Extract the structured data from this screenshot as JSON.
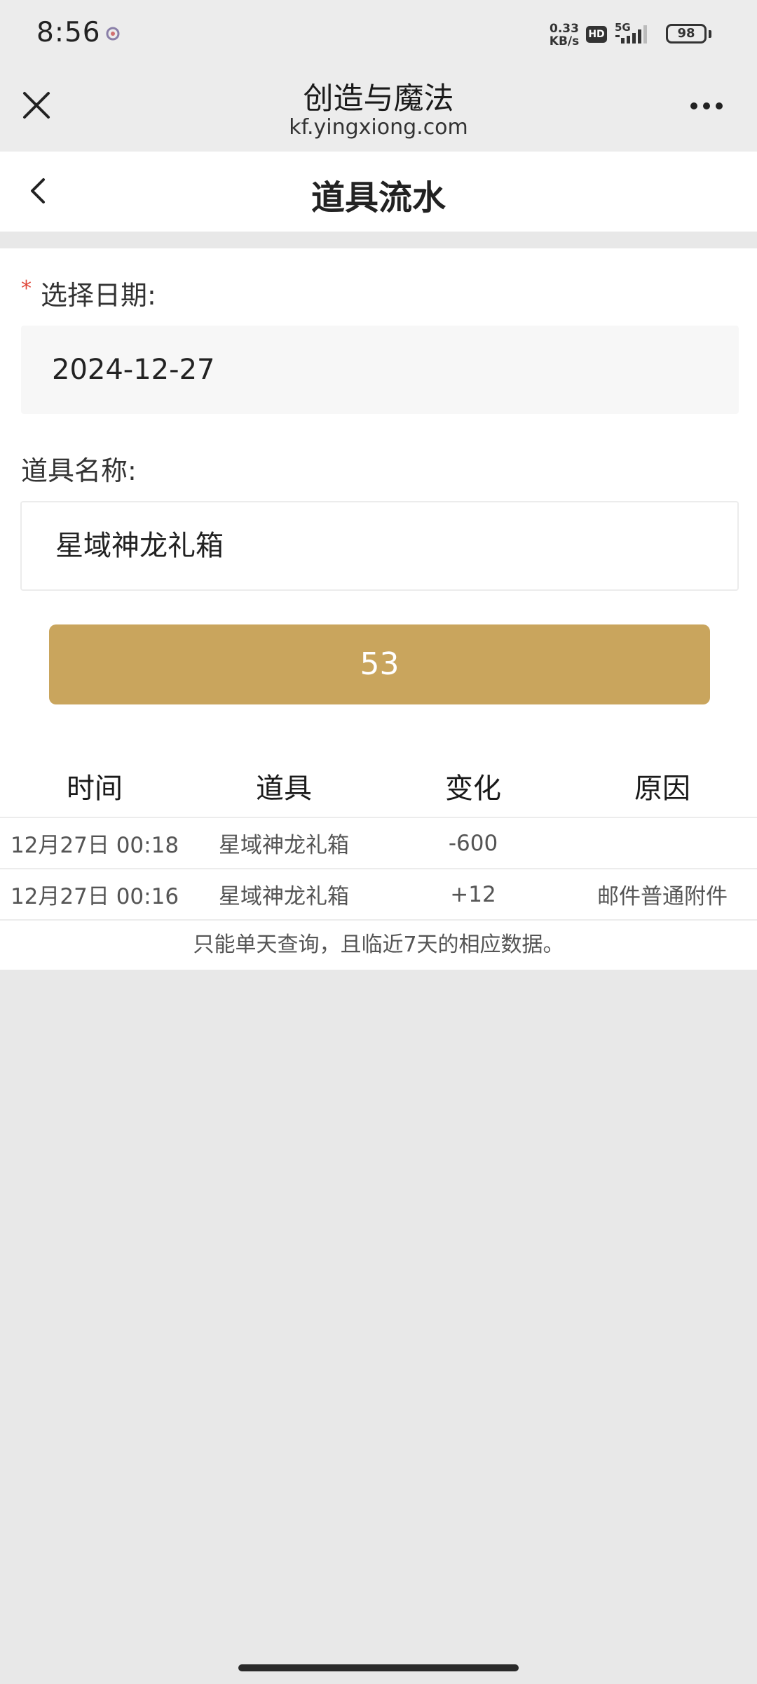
{
  "status_bar": {
    "time": "8:56",
    "net_speed_value": "0.33",
    "net_speed_unit": "KB/s",
    "hd_label": "HD",
    "network_label": "5G",
    "battery_level": "98"
  },
  "webview": {
    "title": "创造与魔法",
    "domain": "kf.yingxiong.com"
  },
  "page": {
    "title": "道具流水"
  },
  "form": {
    "required_mark": "*",
    "date_label": "选择日期:",
    "date_value": "2024-12-27",
    "item_label": "道具名称:",
    "item_value": "星域神龙礼箱",
    "query_button_label": "53"
  },
  "table": {
    "headers": [
      "时间",
      "道具",
      "变化",
      "原因"
    ],
    "rows": [
      {
        "time": "12月27日 00:18",
        "item": "星域神龙礼箱",
        "change": "-600",
        "reason": ""
      },
      {
        "time": "12月27日 00:16",
        "item": "星域神龙礼箱",
        "change": "+12",
        "reason": "邮件普通附件"
      }
    ],
    "footer_note": "只能单天查询，且临近7天的相应数据。"
  },
  "icons": {
    "close": "close-icon",
    "more": "more-icon",
    "back": "chevron-left-icon",
    "signal": "signal-icon",
    "battery": "battery-icon"
  }
}
